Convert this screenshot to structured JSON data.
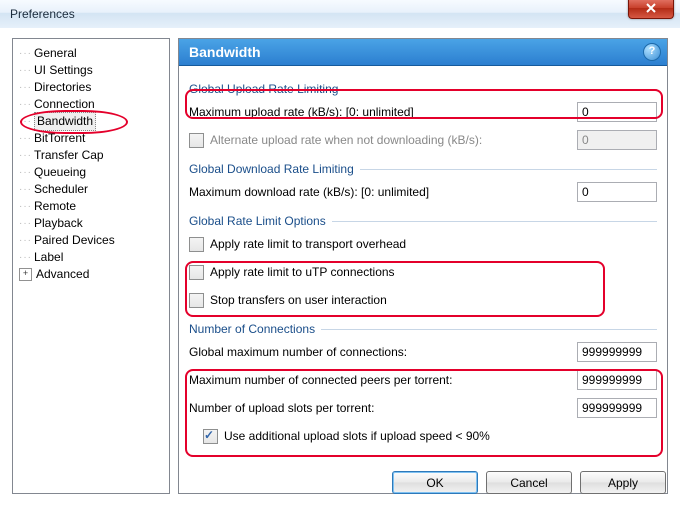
{
  "window": {
    "title": "Preferences"
  },
  "sidebar": {
    "items": [
      {
        "label": "General"
      },
      {
        "label": "UI Settings"
      },
      {
        "label": "Directories"
      },
      {
        "label": "Connection"
      },
      {
        "label": "Bandwidth",
        "selected": true
      },
      {
        "label": "BitTorrent"
      },
      {
        "label": "Transfer Cap"
      },
      {
        "label": "Queueing"
      },
      {
        "label": "Scheduler"
      },
      {
        "label": "Remote"
      },
      {
        "label": "Playback"
      },
      {
        "label": "Paired Devices"
      },
      {
        "label": "Label"
      },
      {
        "label": "Advanced",
        "expandable": true
      }
    ]
  },
  "panel": {
    "title": "Bandwidth"
  },
  "groups": {
    "upload": {
      "title": "Global Upload Rate Limiting",
      "max_label": "Maximum upload rate (kB/s): [0: unlimited]",
      "max_value": "0",
      "alt_label": "Alternate upload rate when not downloading (kB/s):",
      "alt_value": "0",
      "alt_checked": false
    },
    "download": {
      "title": "Global Download Rate Limiting",
      "max_label": "Maximum download rate (kB/s): [0: unlimited]",
      "max_value": "0"
    },
    "options": {
      "title": "Global Rate Limit Options",
      "opt1": "Apply rate limit to transport overhead",
      "opt1_checked": false,
      "opt2": "Apply rate limit to uTP connections",
      "opt2_checked": false,
      "opt3": "Stop transfers on user interaction",
      "opt3_checked": false
    },
    "conns": {
      "title": "Number of Connections",
      "c1_label": "Global maximum number of connections:",
      "c1_value": "999999999",
      "c2_label": "Maximum number of connected peers per torrent:",
      "c2_value": "999999999",
      "c3_label": "Number of upload slots per torrent:",
      "c3_value": "999999999",
      "extra_label": "Use additional upload slots if upload speed < 90%",
      "extra_checked": true
    }
  },
  "footer": {
    "ok": "OK",
    "cancel": "Cancel",
    "apply": "Apply"
  }
}
